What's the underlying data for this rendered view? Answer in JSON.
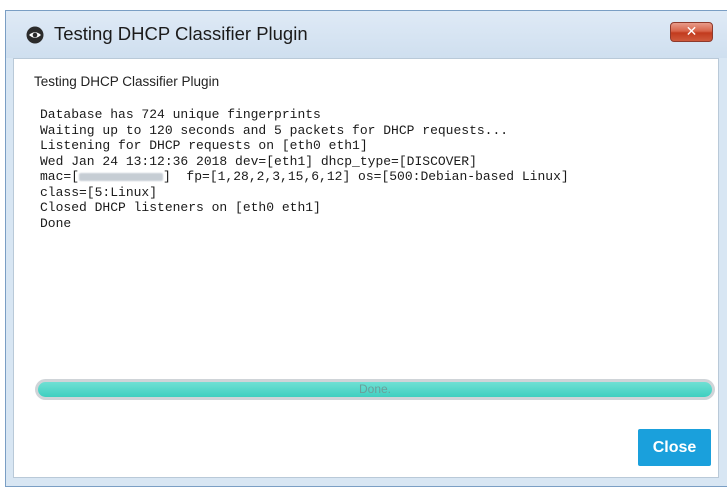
{
  "window": {
    "title": "Testing DHCP Classifier Plugin",
    "close_glyph": "✕"
  },
  "dialog": {
    "subtitle": "Testing DHCP Classifier Plugin",
    "log_lines": {
      "l1": "Database has 724 unique fingerprints",
      "l2": "Waiting up to 120 seconds and 5 packets for DHCP requests...",
      "l3": "Listening for DHCP requests on [eth0 eth1]",
      "l4": "Wed Jan 24 13:12:36 2018 dev=[eth1] dhcp_type=[DISCOVER]",
      "l5_prefix": "mac=[",
      "l5_suffix": "]  fp=[1,28,2,3,15,6,12] os=[500:Debian-based Linux]",
      "l6": "class=[5:Linux]",
      "l7": "Closed DHCP listeners on [eth0 eth1]",
      "l8": "Done"
    },
    "progress": {
      "label": "Done.",
      "value_percent": 100
    },
    "close_button_label": "Close"
  },
  "colors": {
    "accent": "#1aa0dc",
    "progress": "#3fcfc0",
    "titlebar_close": "#c23b1e"
  }
}
